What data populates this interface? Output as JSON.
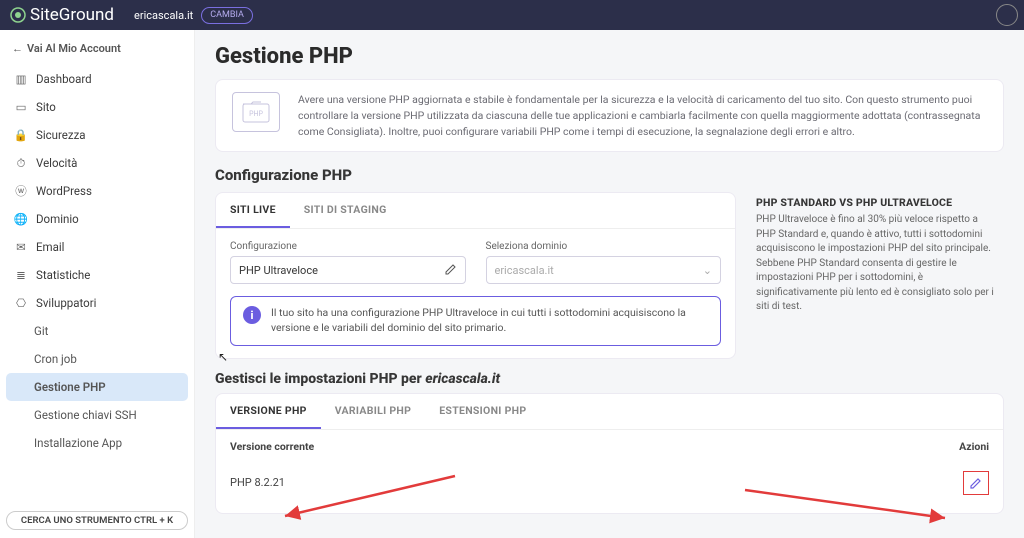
{
  "topbar": {
    "brand": "SiteGround",
    "domain": "ericascala.it",
    "change_label": "CAMBIA"
  },
  "sidebar": {
    "back_label": "Vai Al Mio Account",
    "items": [
      {
        "label": "Dashboard"
      },
      {
        "label": "Sito"
      },
      {
        "label": "Sicurezza"
      },
      {
        "label": "Velocità"
      },
      {
        "label": "WordPress"
      },
      {
        "label": "Dominio"
      },
      {
        "label": "Email"
      },
      {
        "label": "Statistiche"
      },
      {
        "label": "Sviluppatori"
      }
    ],
    "sub_items": [
      {
        "label": "Git"
      },
      {
        "label": "Cron job"
      },
      {
        "label": "Gestione PHP",
        "active": true
      },
      {
        "label": "Gestione chiavi SSH"
      },
      {
        "label": "Installazione App"
      }
    ],
    "search_tool": "CERCA UNO STRUMENTO CTRL + K"
  },
  "page": {
    "title": "Gestione PHP",
    "banner_text": "Avere una versione PHP aggiornata e stabile è fondamentale per la sicurezza e la velocità di caricamento del tuo sito. Con questo strumento puoi controllare la versione PHP utilizzata da ciascuna delle tue applicazioni e cambiarla facilmente con quella maggiormente adottata (contrassegnata come Consigliata). Inoltre, puoi configurare variabili PHP come i tempi di esecuzione, la segnalazione degli errori e altro."
  },
  "config": {
    "section_title": "Configurazione PHP",
    "tabs": {
      "live": "SITI LIVE",
      "staging": "SITI DI STAGING"
    },
    "fields": {
      "config_label": "Configurazione",
      "config_value": "PHP Ultraveloce",
      "domain_label": "Seleziona dominio",
      "domain_value": "ericascala.it"
    },
    "hint": "Il tuo sito ha una configurazione PHP Ultraveloce in cui tutti i sottodomini acquisiscono la versione e le variabili del dominio del sito primario."
  },
  "aside": {
    "title": "PHP STANDARD VS PHP ULTRAVELOCE",
    "text": "PHP Ultraveloce è fino al 30% più veloce rispetto a PHP Standard e, quando è attivo, tutti i sottodomini acquisiscono le impostazioni PHP del sito principale. Sebbene PHP Standard consenta di gestire le impostazioni PHP per i sottodomini, è significativamente più lento ed è consigliato solo per i siti di test."
  },
  "manage": {
    "title_prefix": "Gestisci le impostazioni PHP per ",
    "domain": "ericascala.it",
    "tabs": {
      "version": "VERSIONE PHP",
      "vars": "VARIABILI PHP",
      "ext": "ESTENSIONI PHP"
    },
    "col_version": "Versione corrente",
    "col_actions": "Azioni",
    "current_version": "PHP 8.2.21"
  }
}
